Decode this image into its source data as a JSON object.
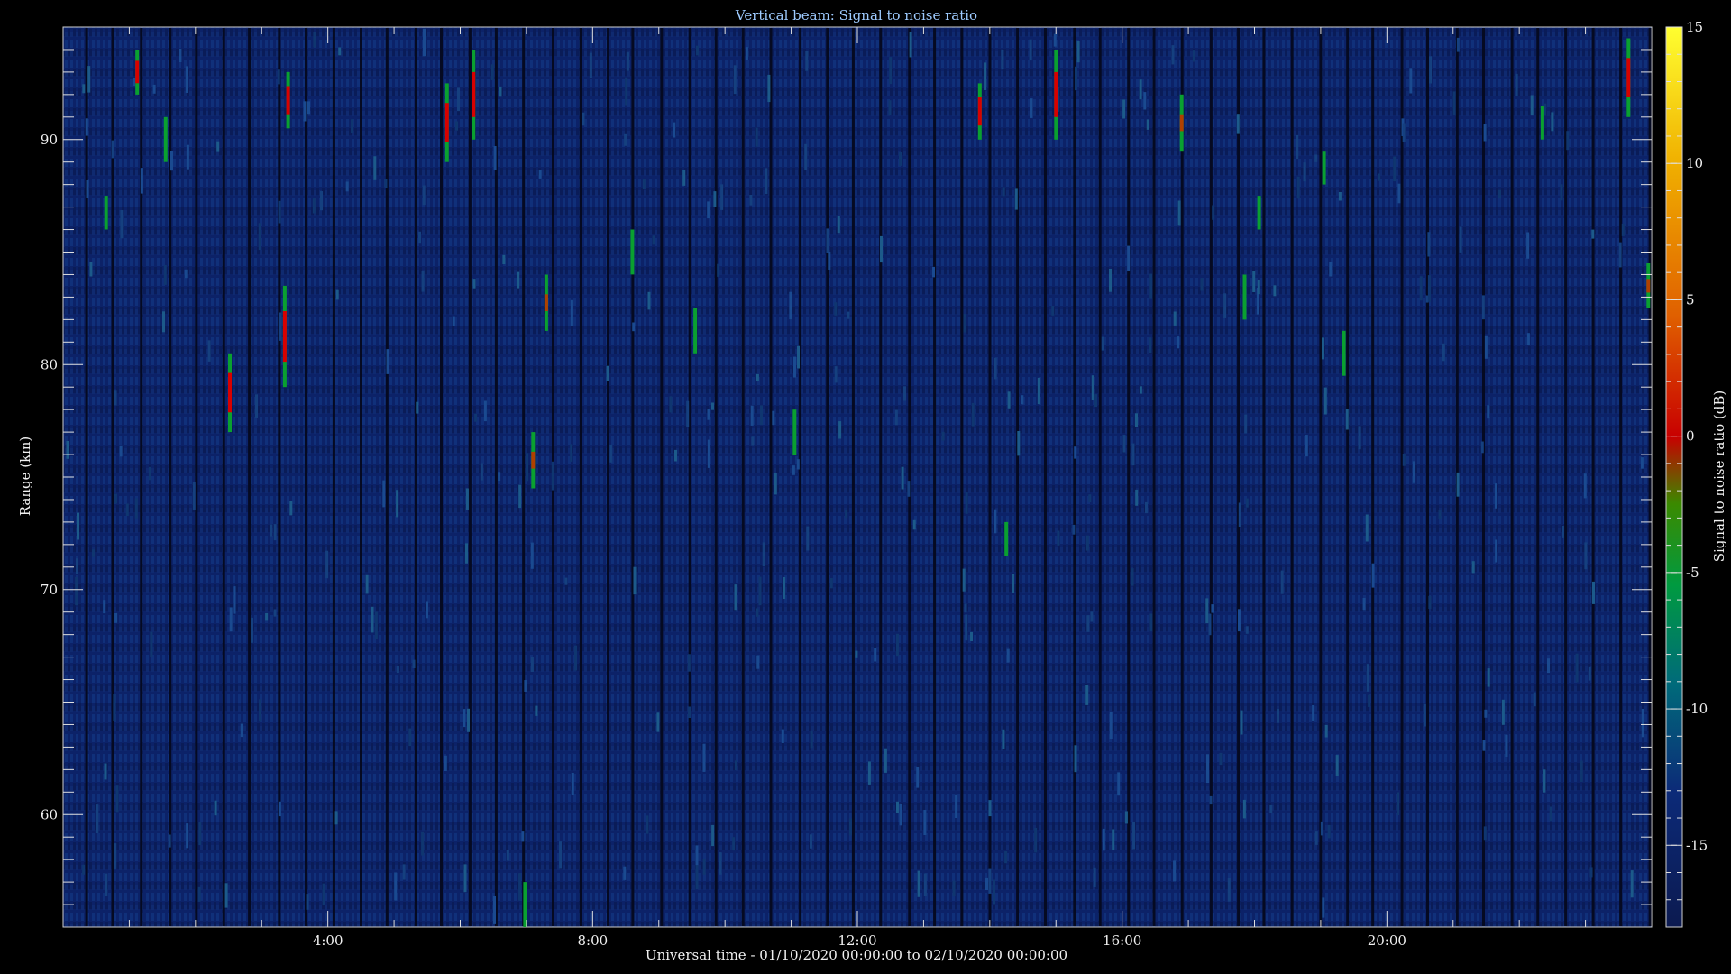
{
  "chart_data": {
    "type": "heatmap",
    "title": "Vertical beam: Signal to noise ratio",
    "xlabel": "Universal time - 01/10/2020 00:00:00 to 02/10/2020 00:00:00",
    "ylabel": "Range (km)",
    "colorbar_label": "Signal to noise ratio (dB)",
    "x_range_hours": [
      0,
      24
    ],
    "y_range_km": [
      55,
      95
    ],
    "x_ticks": [
      {
        "hour": 4,
        "label": "4:00"
      },
      {
        "hour": 8,
        "label": "8:00"
      },
      {
        "hour": 12,
        "label": "12:00"
      },
      {
        "hour": 16,
        "label": "16:00"
      },
      {
        "hour": 20,
        "label": "20:00"
      }
    ],
    "y_ticks": [
      {
        "km": 60,
        "label": "60"
      },
      {
        "km": 70,
        "label": "70"
      },
      {
        "km": 80,
        "label": "80"
      },
      {
        "km": 90,
        "label": "90"
      }
    ],
    "colorbar_range_db": [
      -18,
      15
    ],
    "colorbar_ticks": [
      {
        "db": 15,
        "label": "15"
      },
      {
        "db": 10,
        "label": "10"
      },
      {
        "db": 5,
        "label": "5"
      },
      {
        "db": 0,
        "label": "0"
      },
      {
        "db": -5,
        "label": "-5"
      },
      {
        "db": -10,
        "label": "-10"
      },
      {
        "db": -15,
        "label": "-15"
      }
    ],
    "background_level_db": -15,
    "signal_streaks": [
      {
        "hour": 0.65,
        "km_low": 86.0,
        "km_high": 87.5,
        "peak_db": -5
      },
      {
        "hour": 1.12,
        "km_low": 92.0,
        "km_high": 94.0,
        "peak_db": 2
      },
      {
        "hour": 1.55,
        "km_low": 89.0,
        "km_high": 91.0,
        "peak_db": -4
      },
      {
        "hour": 2.52,
        "km_low": 77.0,
        "km_high": 80.5,
        "peak_db": 0
      },
      {
        "hour": 3.35,
        "km_low": 79.0,
        "km_high": 83.5,
        "peak_db": 2
      },
      {
        "hour": 3.4,
        "km_low": 90.5,
        "km_high": 93.0,
        "peak_db": 2
      },
      {
        "hour": 5.8,
        "km_low": 89.0,
        "km_high": 92.5,
        "peak_db": 1
      },
      {
        "hour": 6.2,
        "km_low": 90.0,
        "km_high": 94.0,
        "peak_db": 2
      },
      {
        "hour": 7.1,
        "km_low": 74.5,
        "km_high": 77.0,
        "peak_db": -1
      },
      {
        "hour": 7.3,
        "km_low": 81.5,
        "km_high": 84.0,
        "peak_db": -3
      },
      {
        "hour": 6.98,
        "km_low": 55.0,
        "km_high": 57.0,
        "peak_db": -6
      },
      {
        "hour": 8.6,
        "km_low": 84.0,
        "km_high": 86.0,
        "peak_db": -6
      },
      {
        "hour": 9.55,
        "km_low": 80.5,
        "km_high": 82.5,
        "peak_db": -7
      },
      {
        "hour": 11.05,
        "km_low": 76.0,
        "km_high": 78.0,
        "peak_db": -6
      },
      {
        "hour": 13.85,
        "km_low": 90.0,
        "km_high": 92.5,
        "peak_db": 2
      },
      {
        "hour": 15.0,
        "km_low": 90.0,
        "km_high": 94.0,
        "peak_db": 2
      },
      {
        "hour": 16.9,
        "km_low": 89.5,
        "km_high": 92.0,
        "peak_db": -1
      },
      {
        "hour": 17.85,
        "km_low": 82.0,
        "km_high": 84.0,
        "peak_db": -5
      },
      {
        "hour": 18.07,
        "km_low": 86.0,
        "km_high": 87.5,
        "peak_db": -8
      },
      {
        "hour": 19.35,
        "km_low": 79.5,
        "km_high": 81.5,
        "peak_db": -6
      },
      {
        "hour": 19.05,
        "km_low": 88.0,
        "km_high": 89.5,
        "peak_db": -9
      },
      {
        "hour": 22.35,
        "km_low": 90.0,
        "km_high": 91.5,
        "peak_db": -8
      },
      {
        "hour": 23.65,
        "km_low": 91.0,
        "km_high": 94.5,
        "peak_db": 2
      },
      {
        "hour": 23.95,
        "km_low": 82.5,
        "km_high": 84.5,
        "peak_db": -2
      },
      {
        "hour": 14.25,
        "km_low": 71.5,
        "km_high": 73.0,
        "peak_db": -9
      }
    ],
    "grid": false,
    "colorbar_position": "right"
  }
}
